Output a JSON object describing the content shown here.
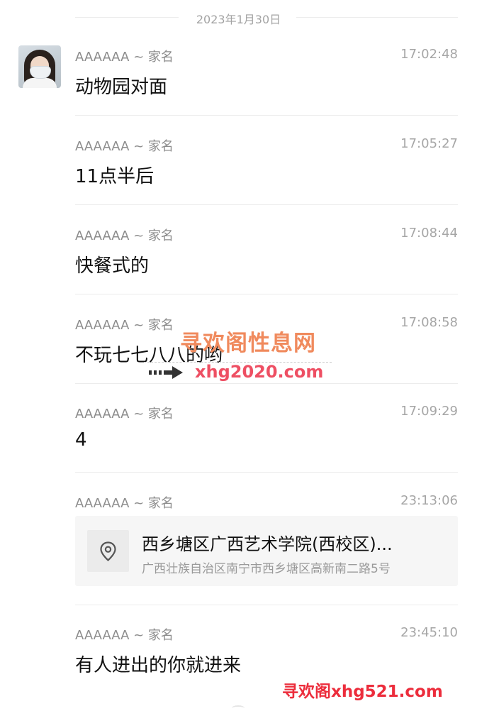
{
  "date_header": "2023年1月30日",
  "messages": [
    {
      "sender": "AAAAAA ~ 家名",
      "time": "17:02:48",
      "text": "动物园对面"
    },
    {
      "sender": "AAAAAA ~ 家名",
      "time": "17:05:27",
      "text": "11点半后"
    },
    {
      "sender": "AAAAAA ~ 家名",
      "time": "17:08:44",
      "text": "快餐式的"
    },
    {
      "sender": "AAAAAA ~ 家名",
      "time": "17:08:58",
      "text": "不玩七七八八的哟"
    },
    {
      "sender": "AAAAAA ~ 家名",
      "time": "17:09:29",
      "text": "4"
    },
    {
      "sender": "AAAAAA ~ 家名",
      "time": "23:13:06",
      "location": {
        "title": "西乡塘区广西艺术学院(西校区)...",
        "address": "广西壮族自治区南宁市西乡塘区高新南二路5号",
        "icon": "location-pin-icon"
      }
    },
    {
      "sender": "AAAAAA ~ 家名",
      "time": "23:45:10",
      "text": "有人进出的你就进来"
    }
  ],
  "watermarks": {
    "line1": "寻欢阁性息网",
    "line2": "xhg2020.com",
    "line3": "寻欢阁xhg521.com"
  },
  "colors": {
    "text": "#111111",
    "meta": "#8c8c8c",
    "separator": "#ececec",
    "card_bg": "#f6f6f6",
    "watermark_orange": "#f08a5d",
    "watermark_red": "#ec2d3c"
  }
}
